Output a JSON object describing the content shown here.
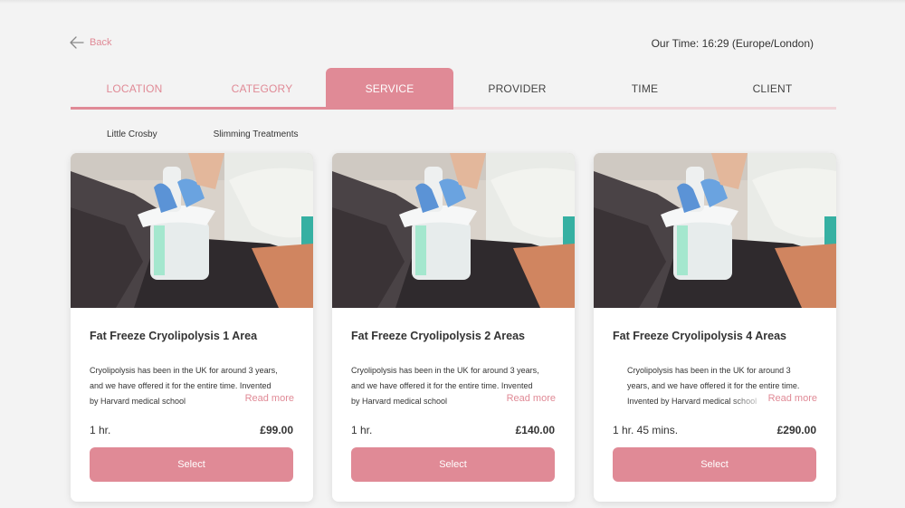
{
  "header": {
    "back_label": "Back",
    "our_time": "Our Time: 16:29 (Europe/London)"
  },
  "steps": [
    {
      "label": "LOCATION",
      "state": "done"
    },
    {
      "label": "CATEGORY",
      "state": "done"
    },
    {
      "label": "SERVICE",
      "state": "active"
    },
    {
      "label": "PROVIDER",
      "state": "pending"
    },
    {
      "label": "TIME",
      "state": "pending"
    },
    {
      "label": "CLIENT",
      "state": "pending"
    }
  ],
  "breadcrumbs": {
    "location": "Little Crosby",
    "category": "Slimming Treatments"
  },
  "colors": {
    "accent": "#e08a96",
    "accent_light": "#f0d5d9",
    "background": "#f3f3f3"
  },
  "services": [
    {
      "title": "Fat Freeze Cryolipolysis 1 Area",
      "description": "Cryolipolysis has been in the UK for around 3 years, and we have offered it for the entire time. Invented by Harvard medical school",
      "read_more": "Read more",
      "duration": "1 hr.",
      "price": "£99.00",
      "select_label": "Select"
    },
    {
      "title": "Fat Freeze Cryolipolysis 2 Areas",
      "description": "Cryolipolysis has been in the UK for around 3 years, and we have offered it for the entire time. Invented by Harvard medical school",
      "read_more": "Read more",
      "duration": "1 hr.",
      "price": "£140.00",
      "select_label": "Select"
    },
    {
      "title": "Fat Freeze Cryolipolysis 4 Areas",
      "description": "Cryolipolysis has been in the UK for around 3 years, and we have offered it for the entire time. Invented by Harvard medical school",
      "read_more": "Read more",
      "duration": "1 hr. 45 mins.",
      "price": "£290.00",
      "select_label": "Select"
    }
  ]
}
